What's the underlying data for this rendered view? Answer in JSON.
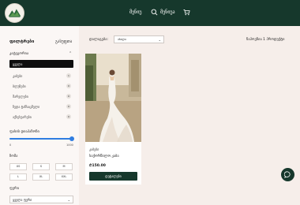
{
  "header": {
    "logo_icon": "shop-logo",
    "nav_main": "მენიუ",
    "search_icon": "search-icon",
    "search_label": "მენიუა",
    "cart_icon": "cart-icon",
    "bg_color": "#16382c"
  },
  "sidebar": {
    "title": "ფილტრები",
    "clear": "გასუფთა",
    "categories_head": "კატეგორია",
    "categories": [
      {
        "label": "ყველა",
        "count": "",
        "active": true
      },
      {
        "label": "კაბები",
        "count": "1",
        "active": false
      },
      {
        "label": "ბლუზები",
        "count": "0",
        "active": false
      },
      {
        "label": "შარვლები",
        "count": "0",
        "active": false
      },
      {
        "label": "ზედა ტანსაცმელი",
        "count": "0",
        "active": false
      },
      {
        "label": "აქსესუარები",
        "count": "0",
        "active": false
      }
    ],
    "price_head": "ფასის დიაპაზონი",
    "price_min": "0",
    "price_max": "1000",
    "price_range_fraction": [
      0,
      1
    ],
    "size_head": "ზომა",
    "sizes": [
      "XS",
      "S",
      "M",
      "L",
      "XL",
      "XXL"
    ],
    "color_head": "ფერი",
    "color_value": "ყველა ფერი"
  },
  "main": {
    "sort_label": "დალაგება:",
    "sort_value": "ახალი",
    "result_count": "ნაპოვნია 1 პროდუქტი",
    "product": {
      "category": "კაბები",
      "name": "საქორწილო კაბა",
      "price": "₾150.00",
      "button": "დეტალები"
    }
  },
  "chat_icon": "chat-icon",
  "accent_color": "#2f7de1"
}
